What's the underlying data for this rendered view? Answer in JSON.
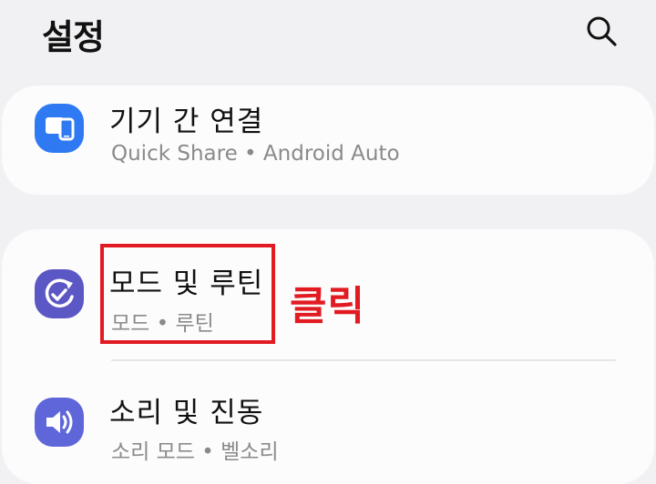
{
  "header": {
    "title": "설정",
    "search_icon": "search-icon"
  },
  "items": [
    {
      "title": "기기 간 연결",
      "subtitle": "Quick Share  •  Android Auto",
      "icon": "connected-devices-icon",
      "icon_color": "#2f7af2"
    },
    {
      "title": "모드 및 루틴",
      "subtitle": "모드  •  루틴",
      "icon": "modes-routines-icon",
      "icon_color": "#5b57c4"
    },
    {
      "title": "소리 및 진동",
      "subtitle": "소리 모드  •  벨소리",
      "icon": "sound-icon",
      "icon_color": "#5e66d9"
    }
  ],
  "annotation": {
    "text": "클릭",
    "color": "#e21b23"
  }
}
